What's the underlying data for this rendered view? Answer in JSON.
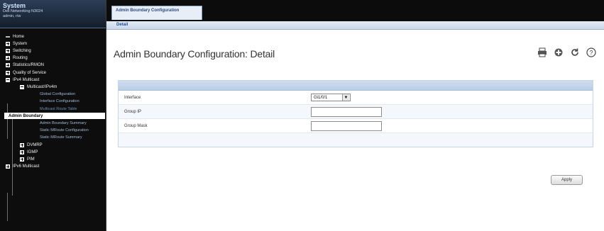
{
  "sidebar": {
    "brand": {
      "title": "System",
      "line1": "Dell Networking N3024",
      "line2": "admin, r/w"
    },
    "tree": [
      {
        "label": "Home",
        "type": "dash"
      },
      {
        "label": "System",
        "type": "plus"
      },
      {
        "label": "Switching",
        "type": "plus"
      },
      {
        "label": "Routing",
        "type": "plus"
      },
      {
        "label": "Statistics/RMON",
        "type": "plus"
      },
      {
        "label": "Quality of Service",
        "type": "plus"
      },
      {
        "label": "IPv4 Multicast",
        "type": "minus"
      },
      {
        "label": "Multicast/IPv4m",
        "type": "minus"
      },
      {
        "label": "Global Configuration",
        "type": "leaf"
      },
      {
        "label": "Interface Configuration",
        "type": "leaf"
      },
      {
        "label": "Multicast Route Table",
        "type": "leaf"
      },
      {
        "label": "Admin Boundary",
        "type": "selected"
      },
      {
        "label": "Admin Boundary Summary",
        "type": "leaf"
      },
      {
        "label": "Static MRoute Configuration",
        "type": "leaf"
      },
      {
        "label": "Static MRoute Summary",
        "type": "leaf"
      },
      {
        "label": "DVMRP",
        "type": "plus"
      },
      {
        "label": "IGMP",
        "type": "plus"
      },
      {
        "label": "PIM",
        "type": "plus"
      },
      {
        "label": "IPv6 Multicast",
        "type": "plus"
      }
    ]
  },
  "topbar": {
    "tab_label": "Admin Boundary Configuration"
  },
  "subbar": {
    "link_label": "Detail"
  },
  "main": {
    "title": "Admin Boundary Configuration: Detail",
    "toolbar_icons": [
      "print-icon",
      "add-icon",
      "refresh-icon",
      "help-icon"
    ],
    "form": {
      "interface_label": "Interface",
      "interface_value": "Gi1/0/1",
      "group_ip_label": "Group IP",
      "group_ip_value": "",
      "group_mask_label": "Group Mask",
      "group_mask_value": ""
    },
    "apply_label": "Apply"
  },
  "colors": {
    "accent": "#1e4b96",
    "sidebar_bg": "#0d0d0d",
    "panel_header": "#c4d5ea"
  }
}
